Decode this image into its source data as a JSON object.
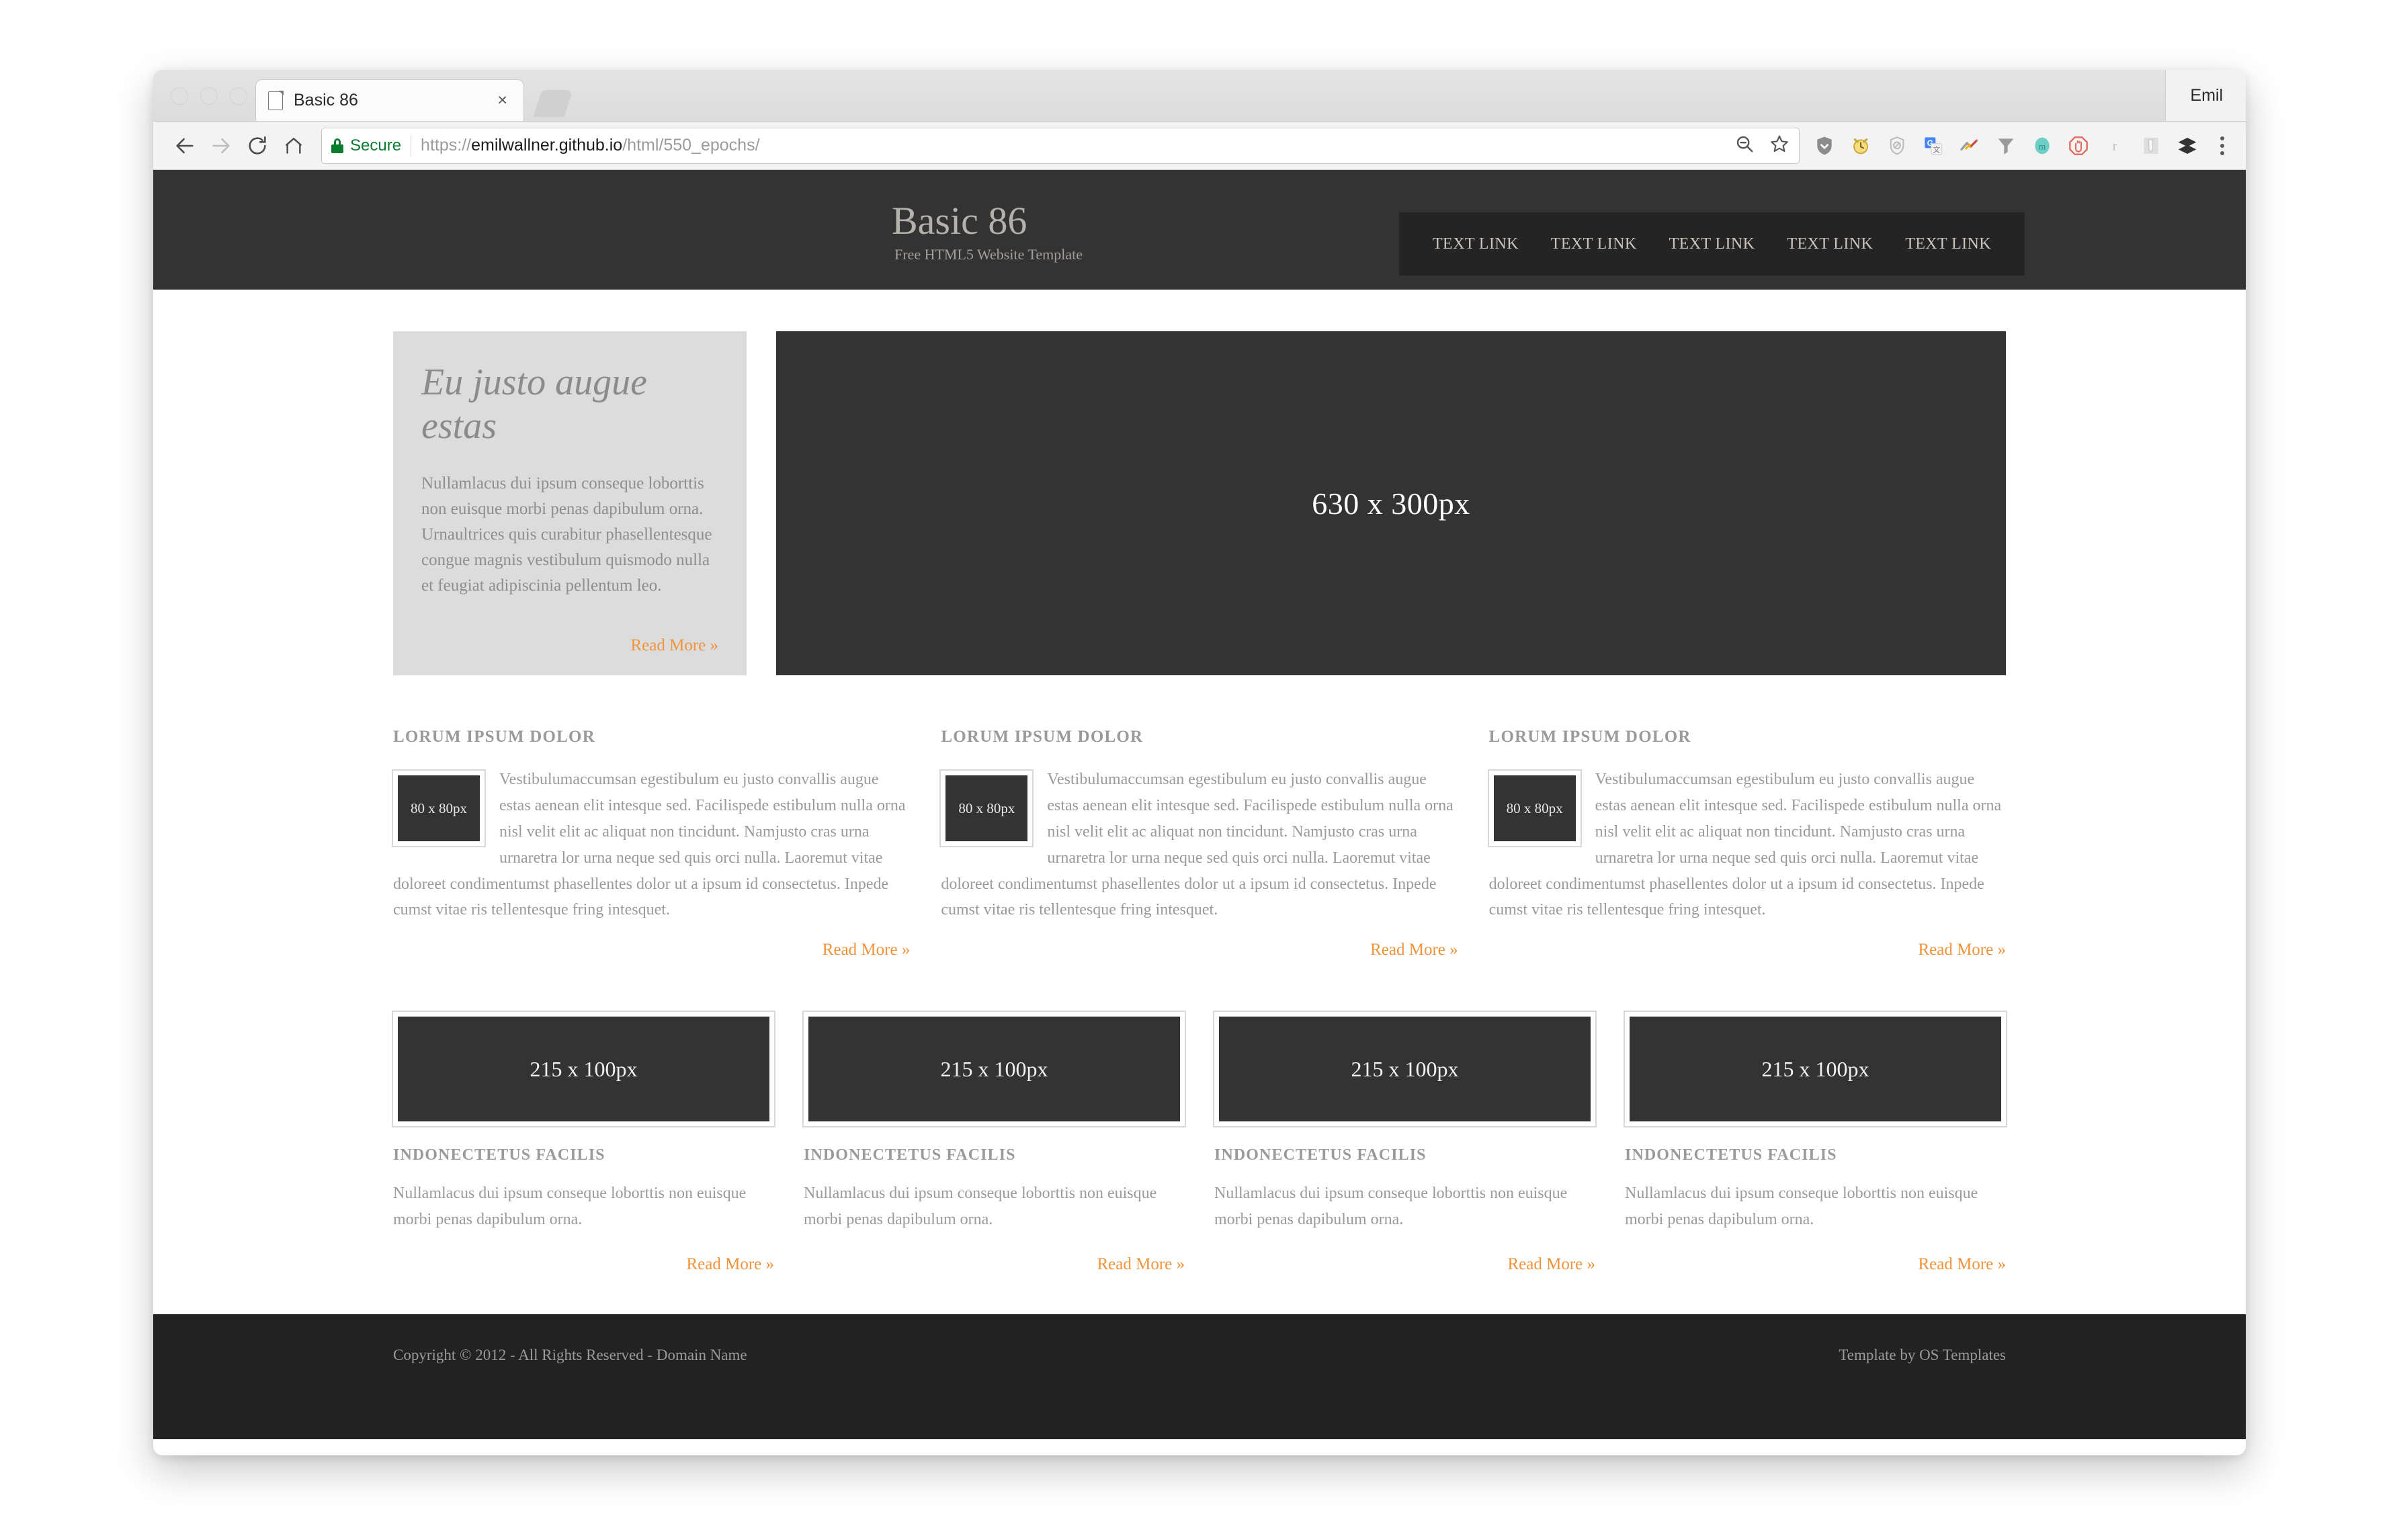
{
  "browser": {
    "tab": {
      "title": "Basic 86",
      "favicon": "page-icon",
      "close": "×"
    },
    "profile": "Emil",
    "omnibox": {
      "security_label": "Secure",
      "url_scheme": "https://",
      "url_host": "emilwallner.github.io",
      "url_path": "/html/550_epochs/",
      "url_full": "https://emilwallner.github.io/html/550_epochs/"
    },
    "extensions": [
      "shield-down-icon",
      "alarm-clock-icon",
      "block-shield-icon",
      "google-translate-icon",
      "adblock-arrow-icon",
      "funnel-icon",
      "m-circle-icon",
      "stop-hand-icon",
      "r-letter-icon",
      "note-icon",
      "layers-icon"
    ],
    "omnibox_actions": [
      "zoom-out-icon",
      "bookmark-star-icon"
    ],
    "nav_actions": [
      "back-icon",
      "forward-icon",
      "reload-icon",
      "home-icon"
    ],
    "menu": "three-dot-menu-icon"
  },
  "site": {
    "brand": {
      "title": "Basic 86",
      "tagline": "Free HTML5 Website Template"
    },
    "nav": [
      {
        "label": "TEXT LINK"
      },
      {
        "label": "TEXT LINK"
      },
      {
        "label": "TEXT LINK"
      },
      {
        "label": "TEXT LINK"
      },
      {
        "label": "TEXT LINK"
      }
    ],
    "hero": {
      "aside": {
        "heading": "Eu justo augue estas",
        "body": "Nullamlacus dui ipsum conseque loborttis non euisque morbi penas dapibulum orna. Urnaultrices quis curabitur phasellentesque congue magnis vestibulum quismodo nulla et feugiat adipiscinia pellentum leo.",
        "read_more": "Read More »"
      },
      "banner_placeholder": "630 x 300px"
    },
    "three_columns": [
      {
        "heading": "LORUM IPSUM DOLOR",
        "thumb": "80 x 80px",
        "body": "Vestibulumaccumsan egestibulum eu justo convallis augue estas aenean elit intesque sed. Facilispede estibulum nulla orna nisl velit elit ac aliquat non tincidunt. Namjusto cras urna urnaretra lor urna neque sed quis orci nulla. Laoremut vitae doloreet condimentumst phasellentes dolor ut a ipsum id consectetus. Inpede cumst vitae ris tellentesque fring intesquet.",
        "read_more": "Read More »"
      },
      {
        "heading": "LORUM IPSUM DOLOR",
        "thumb": "80 x 80px",
        "body": "Vestibulumaccumsan egestibulum eu justo convallis augue estas aenean elit intesque sed. Facilispede estibulum nulla orna nisl velit elit ac aliquat non tincidunt. Namjusto cras urna urnaretra lor urna neque sed quis orci nulla. Laoremut vitae doloreet condimentumst phasellentes dolor ut a ipsum id consectetus. Inpede cumst vitae ris tellentesque fring intesquet.",
        "read_more": "Read More »"
      },
      {
        "heading": "LORUM IPSUM DOLOR",
        "thumb": "80 x 80px",
        "body": "Vestibulumaccumsan egestibulum eu justo convallis augue estas aenean elit intesque sed. Facilispede estibulum nulla orna nisl velit elit ac aliquat non tincidunt. Namjusto cras urna urnaretra lor urna neque sed quis orci nulla. Laoremut vitae doloreet condimentumst phasellentes dolor ut a ipsum id consectetus. Inpede cumst vitae ris tellentesque fring intesquet.",
        "read_more": "Read More »"
      }
    ],
    "four_columns": [
      {
        "thumb": "215 x 100px",
        "heading": "INDONECTETUS FACILIS",
        "body": "Nullamlacus dui ipsum conseque loborttis non euisque morbi penas dapibulum orna.",
        "read_more": "Read More »"
      },
      {
        "thumb": "215 x 100px",
        "heading": "INDONECTETUS FACILIS",
        "body": "Nullamlacus dui ipsum conseque loborttis non euisque morbi penas dapibulum orna.",
        "read_more": "Read More »"
      },
      {
        "thumb": "215 x 100px",
        "heading": "INDONECTETUS FACILIS",
        "body": "Nullamlacus dui ipsum conseque loborttis non euisque morbi penas dapibulum orna.",
        "read_more": "Read More »"
      },
      {
        "thumb": "215 x 100px",
        "heading": "INDONECTETUS FACILIS",
        "body": "Nullamlacus dui ipsum conseque loborttis non euisque morbi penas dapibulum orna.",
        "read_more": "Read More »"
      }
    ],
    "footer": {
      "copyright": "Copyright © 2012 - All Rights Reserved - Domain Name",
      "credit": "Template by OS Templates"
    }
  },
  "colors": {
    "header_bg": "#333333",
    "nav_bg": "#242424",
    "footer_bg": "#222222",
    "accent_link": "#f0933b",
    "body_text": "#9a9a9a",
    "aside_bg": "#dcdcdc",
    "secure_green": "#0a7c2f"
  }
}
